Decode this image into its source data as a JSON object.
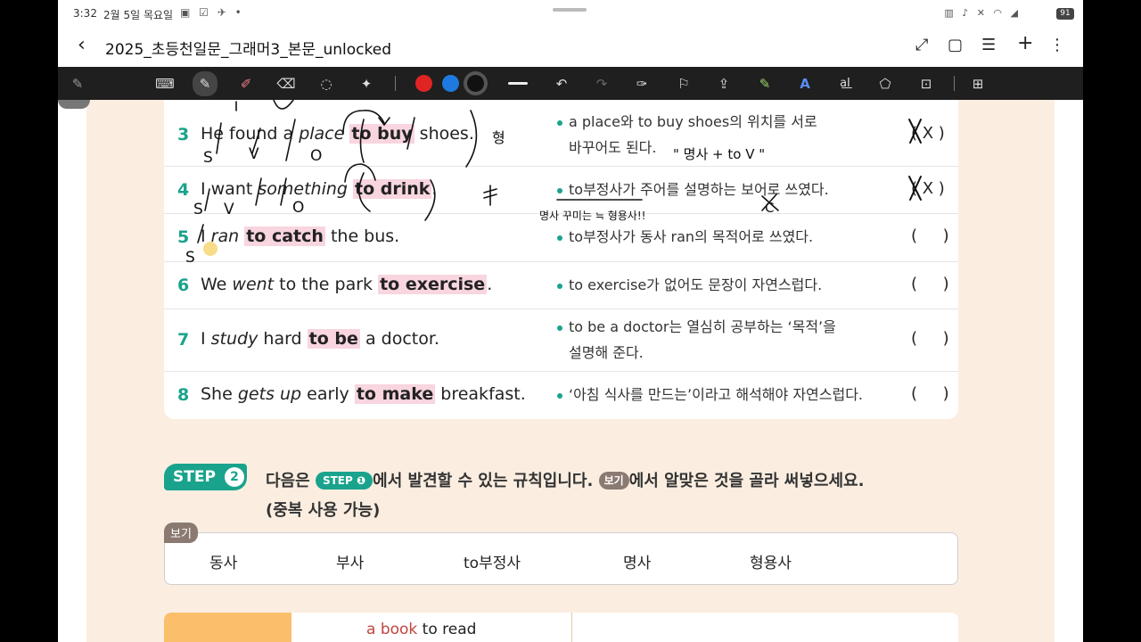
{
  "status": {
    "time": "3:32",
    "date": "2월 5일 목요일",
    "left_icons": "▣ ☑ ✈ •",
    "right_icons": "▥ ♪ ✕ ◠ ◢",
    "battery": "91"
  },
  "titlebar": {
    "back_icon": "‹",
    "title": "2025_초등천일문_그래머3_본문_unlocked",
    "icons": [
      "⤢",
      "▢",
      "☰",
      "+",
      "⋮"
    ]
  },
  "toolbar": {
    "pen_icon": "✎",
    "tools": [
      "⌨",
      "✎",
      "✐",
      "⌫",
      "◌",
      "✦"
    ],
    "colors": [
      "#e02424",
      "#1f7ae0",
      "#111111"
    ],
    "undo": "↶",
    "redo": "↷",
    "tools2": [
      "✑",
      "⚐",
      "⇪",
      "✎",
      "A",
      "a͟I",
      "⬠",
      "⊡",
      "⊞"
    ]
  },
  "rows": [
    {
      "num": "3",
      "pre": "He found a ",
      "italic": "place",
      "mid": " ",
      "hl": "to buy",
      "post": " shoes.",
      "expl": [
        "a place와 to buy shoes의 위치를 서로",
        "바꾸어도 된다."
      ],
      "answer": "( X )"
    },
    {
      "num": "4",
      "pre": "I want ",
      "italic": "something",
      "mid": " ",
      "hl": "to drink",
      "post": ".",
      "expl": [
        "to부정사가 주어를 설명하는 보어로 쓰였다."
      ],
      "answer": "( X )"
    },
    {
      "num": "5",
      "pre": "I ",
      "italic": "ran",
      "mid": " ",
      "hl": "to catch",
      "post": " the bus.",
      "expl": [
        "to부정사가 동사 ran의 목적어로 쓰였다."
      ],
      "answer": "(     )"
    },
    {
      "num": "6",
      "pre": "We ",
      "italic": "went",
      "mid": " to the park ",
      "hl": "to exercise",
      "post": ".",
      "expl": [
        "to exercise가 없어도 문장이 자연스럽다."
      ],
      "answer": "(     )"
    },
    {
      "num": "7",
      "pre": "I ",
      "italic": "study",
      "mid": " hard ",
      "hl": "to be",
      "post": " a doctor.",
      "expl": [
        "to be a doctor는 열심히 공부하는 ‘목적’을",
        "설명해 준다."
      ],
      "answer": "(     )"
    },
    {
      "num": "8",
      "pre": "She ",
      "italic": "gets up",
      "mid": " early ",
      "hl": "to make",
      "post": " breakfast.",
      "expl": [
        "‘아침 식사를 만드는’이라고 해석해야 자연스럽다."
      ],
      "answer": "(     )"
    }
  ],
  "step2": {
    "badge": "STEP",
    "badge_num": "2",
    "inst_1": "다음은 ",
    "chip_step": "STEP",
    "chip_num": "❶",
    "inst_2": "에서 발견할 수 있는 규칙입니다. ",
    "chip_bogi": "보기",
    "inst_3": "에서 알맞은 것을 골라 써넣으세요.",
    "inst_line2": "(중복 사용 가능)"
  },
  "bogi": {
    "tag": "보기",
    "words": [
      "동사",
      "부사",
      "to부정사",
      "명사",
      "형용사"
    ]
  },
  "bottom": {
    "example_a": "a book",
    "example_b": "to read"
  },
  "handwriting": {
    "r3_note": "\" 명사 + to V \"",
    "r3_side": "형",
    "r3_marks": [
      "S",
      "V",
      "O"
    ],
    "r4_marks": [
      "S",
      "V",
      "O"
    ],
    "r4_side": "≠",
    "r4_note": "명사 꾸미는 ≒ 형용사!!",
    "r4_c": "C",
    "r5_mark": "S"
  }
}
